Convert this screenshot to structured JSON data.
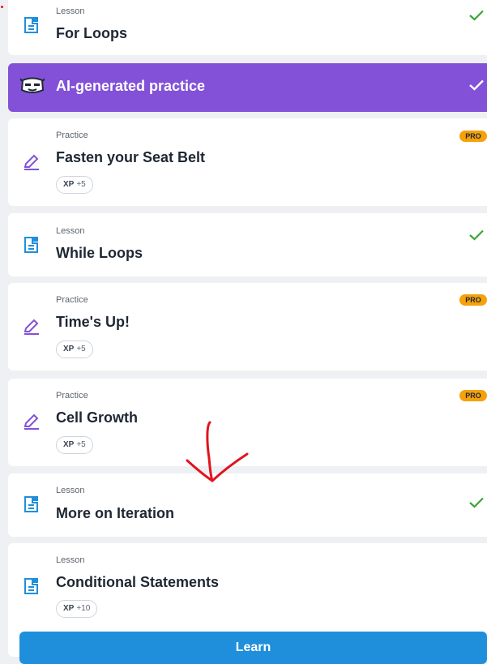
{
  "items": [
    {
      "kind": "Lesson",
      "title": "For Loops",
      "status": "completed"
    },
    {
      "kind": "",
      "title": "AI-generated practice",
      "status": "completed",
      "variant": "ai"
    },
    {
      "kind": "Practice",
      "title": "Fasten your Seat Belt",
      "badge": "PRO",
      "xp_label": "XP",
      "xp_value": "+5"
    },
    {
      "kind": "Lesson",
      "title": "While Loops",
      "status": "completed"
    },
    {
      "kind": "Practice",
      "title": "Time's Up!",
      "badge": "PRO",
      "xp_label": "XP",
      "xp_value": "+5"
    },
    {
      "kind": "Practice",
      "title": "Cell Growth",
      "badge": "PRO",
      "xp_label": "XP",
      "xp_value": "+5"
    },
    {
      "kind": "Lesson",
      "title": "More on Iteration",
      "status": "completed"
    },
    {
      "kind": "Lesson",
      "title": "Conditional Statements",
      "xp_label": "XP",
      "xp_value": "+10"
    }
  ],
  "learn_button": {
    "label": "Learn"
  },
  "colors": {
    "ai_background": "#8251d8",
    "pro_badge": "#f5a10a",
    "check": "#3aa636",
    "lesson_icon": "#1f8fdc",
    "practice_icon": "#8251d8",
    "learn_button": "#1f8fdc",
    "annotation": "#e0141e"
  },
  "icons": {
    "lesson": "document-icon",
    "practice": "pencil-icon",
    "ai": "robot-face-icon",
    "status": "check-icon"
  }
}
